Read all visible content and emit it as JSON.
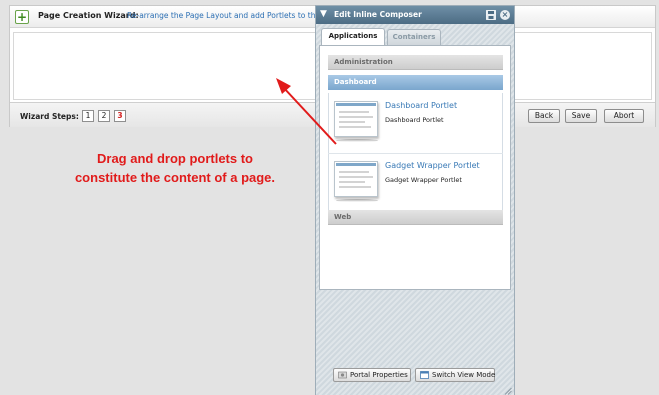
{
  "wizard": {
    "title": "Page Creation Wizard:",
    "description": "Re-arrange the Page Layout and add Portlets to the Page",
    "steps_label": "Wizard Steps:",
    "steps": [
      "1",
      "2",
      "3"
    ],
    "current_step": "3",
    "buttons": {
      "back": "Back",
      "save": "Save",
      "abort": "Abort"
    }
  },
  "composer": {
    "title": "Edit Inline Composer",
    "tabs": {
      "applications": "Applications",
      "containers": "Containers"
    },
    "categories": {
      "administration": "Administration",
      "dashboard": "Dashboard",
      "web": "Web"
    },
    "portlets": [
      {
        "title": "Dashboard Portlet",
        "description": "Dashboard Portlet"
      },
      {
        "title": "Gadget Wrapper Portlet",
        "description": "Gadget Wrapper Portlet"
      }
    ],
    "footer": {
      "portal_properties": "Portal Properties",
      "switch_view_mode": "Switch View Mode"
    }
  },
  "annotation": {
    "line1": "Drag and drop portlets to",
    "line2": "constitute the content of a page."
  },
  "colors": {
    "annotation_red": "#e11b1b",
    "link_blue": "#2c6fb3",
    "composer_header": "#5a7a91",
    "dashboard_bar": "#8cb4d8"
  },
  "icons": [
    "add-page-icon",
    "chevron-down-icon",
    "save-icon",
    "close-icon",
    "portal-properties-icon",
    "switch-view-mode-icon",
    "resize-grip-icon",
    "portlet-thumbnail-icon"
  ]
}
